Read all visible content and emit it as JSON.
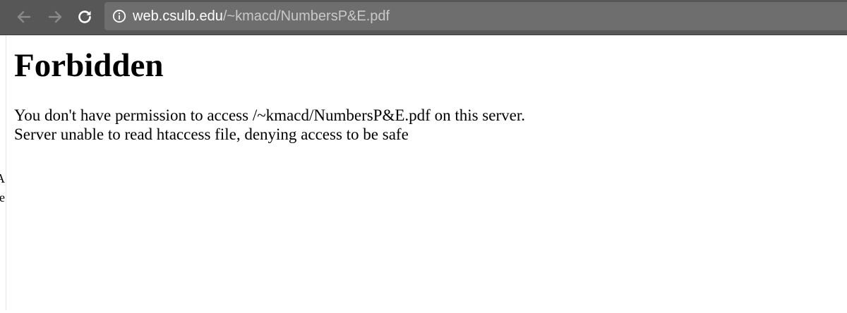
{
  "browser": {
    "url_host": "web.csulb.edu",
    "url_path": "/~kmacd/NumbersP&E.pdf",
    "icons": {
      "back": "arrow-left-icon",
      "forward": "arrow-right-icon",
      "reload": "reload-icon",
      "info": "info-circle-icon"
    }
  },
  "page": {
    "title": "Forbidden",
    "line1": "You don't have permission to access /~kmacd/NumbersP&E.pdf on this server.",
    "line2": "Server unable to read htaccess file, denying access to be safe"
  },
  "background_fragments": [
    "A",
    "le",
    "I"
  ],
  "colors": {
    "toolbar": "#575757",
    "omnibox": "#6e6e6e",
    "url_host": "#ffffff",
    "url_path": "#c9c9c9",
    "page_bg": "#ffffff",
    "text": "#000000"
  }
}
